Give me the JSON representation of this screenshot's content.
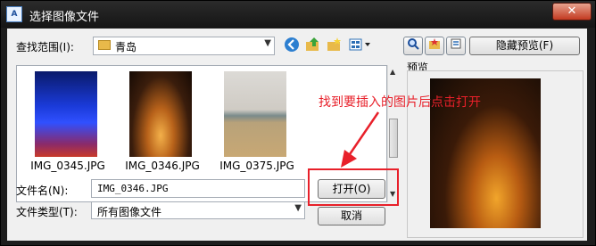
{
  "window": {
    "title": "选择图像文件",
    "app_icon_text": "A",
    "close_glyph": "✕"
  },
  "lookin": {
    "label": "查找范围(I):",
    "value": "青岛"
  },
  "toolbar": {
    "back_icon": "back-icon",
    "up_icon": "up-folder-icon",
    "newfolder_icon": "new-folder-icon",
    "views_icon": "views-menu-icon"
  },
  "right_tools": {
    "hide_preview_label": "隐藏预览(F)"
  },
  "files": [
    {
      "name": "IMG_0345.JPG"
    },
    {
      "name": "IMG_0346.JPG"
    },
    {
      "name": "IMG_0375.JPG"
    }
  ],
  "preview": {
    "label": "预览"
  },
  "annotation": {
    "text": "找到要插入的图片后点击打开",
    "color": "#e8202a"
  },
  "filename": {
    "label": "文件名(N):",
    "value": "IMG_0346.JPG"
  },
  "filetype": {
    "label": "文件类型(T):",
    "value": "所有图像文件"
  },
  "buttons": {
    "open": "打开(O)",
    "cancel": "取消"
  }
}
